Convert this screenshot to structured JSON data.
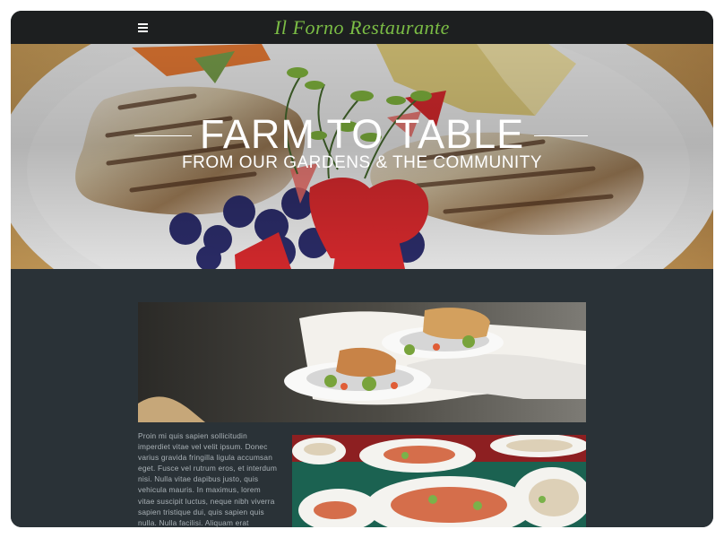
{
  "header": {
    "brand": "Il Forno Restaurante",
    "menu_icon": "hamburger-menu-icon"
  },
  "hero": {
    "title": "FARM TO TABLE",
    "subtitle": "FROM OUR GARDENS & THE COMMUNITY"
  },
  "content": {
    "paragraph": "Proin mi quis sapien sollicitudin imperdiet vitae vel velit ipsum. Donec varius gravida fringilla ligula accumsan eget. Fusce vel rutrum eros, et interdum nisi. Nulla vitae dapibus justo, quis vehicula mauris. In maximus, lorem vitae suscipit luctus, neque nibh viverra sapien tristique dui, quis sapien quis nulla. Nulla facilisi. Aliquam erat volutpat."
  },
  "colors": {
    "topbar": "#1d1f20",
    "brand": "#7bbd45",
    "content_bg": "#2a3237",
    "text": "#aab2b7"
  }
}
